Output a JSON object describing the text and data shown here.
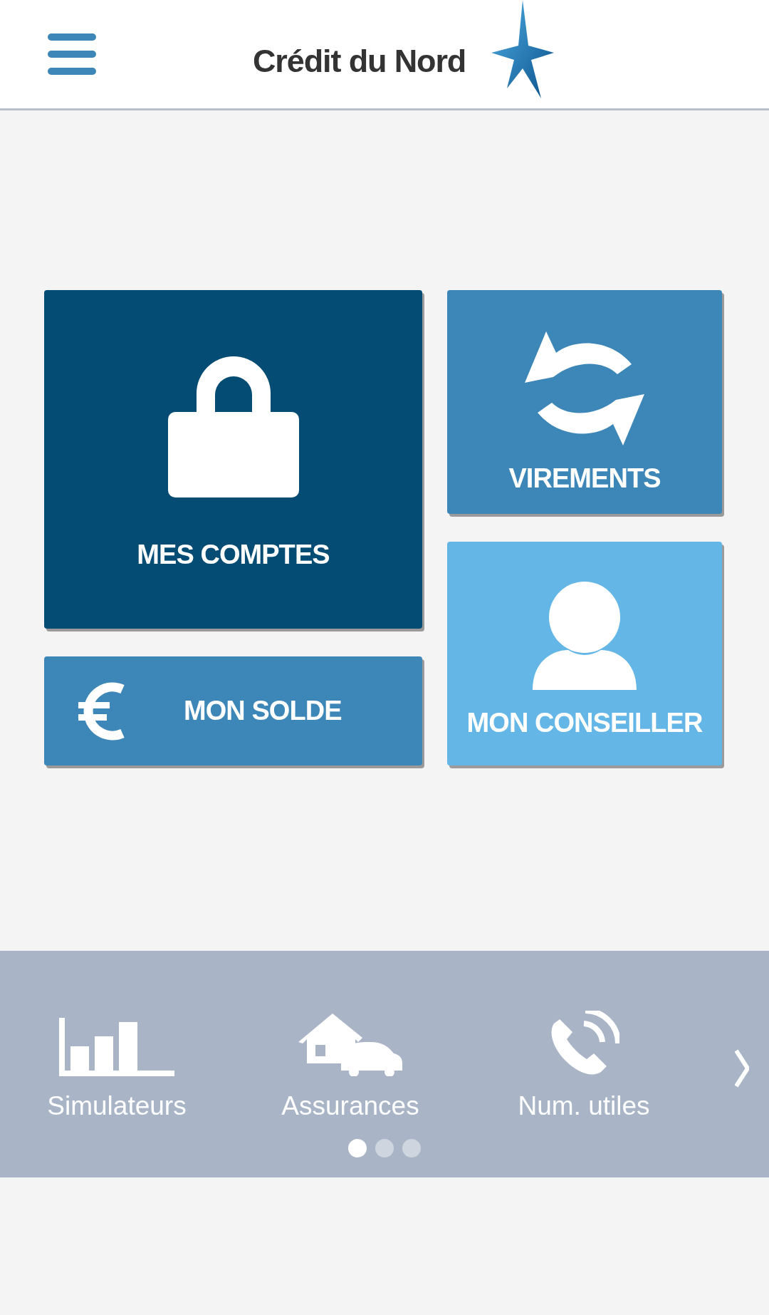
{
  "header": {
    "logo_text": "Crédit du Nord"
  },
  "tiles": [
    {
      "kind": "lock",
      "label": "MES COMPTES",
      "color": "#054c74"
    },
    {
      "kind": "euro",
      "label": "MON SOLDE",
      "color": "#3d87b8"
    },
    {
      "kind": "transfer",
      "label": "VIREMENTS",
      "color": "#3d87b8"
    },
    {
      "kind": "person",
      "label": "MON CONSEILLER",
      "color": "#63b6e6"
    }
  ],
  "shortcuts": [
    {
      "kind": "chart",
      "label": "Simulateurs"
    },
    {
      "kind": "house",
      "label": "Assurances"
    },
    {
      "kind": "phone",
      "label": "Num. utiles"
    }
  ],
  "pager": [
    {
      "selected": true
    },
    {
      "selected": false
    },
    {
      "selected": false
    }
  ]
}
